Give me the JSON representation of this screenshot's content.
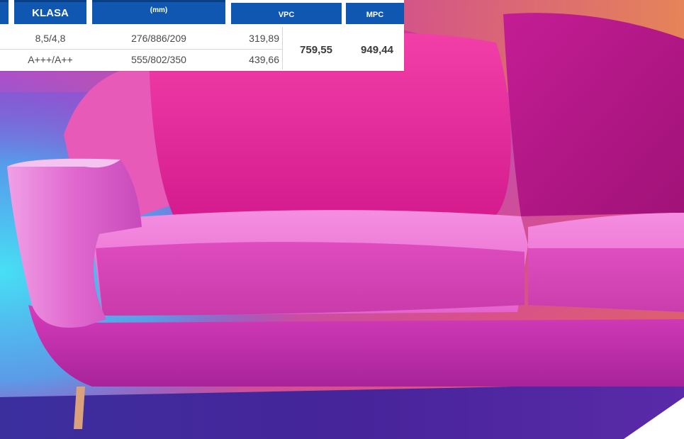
{
  "table": {
    "headers": {
      "klasa": "KLASA",
      "dims": "(mm)",
      "vpc": "VPC",
      "mpc": "MPC"
    },
    "rows": [
      {
        "klasa": "8,5/4,8",
        "dims": "276/886/209",
        "vpc": "319,89"
      },
      {
        "klasa": "A+++/A++",
        "dims": "555/802/350",
        "vpc": "439,66"
      }
    ],
    "totals": {
      "vpc": "759,55",
      "mpc": "949,44"
    }
  },
  "colors": {
    "header_blue": "#0f57b0",
    "sofa_magenta": "#d21b8f",
    "background_orange": "#e8804f",
    "background_cyan": "#3fd0ee"
  },
  "scene": {
    "subject": "pink-sofa-photo"
  }
}
